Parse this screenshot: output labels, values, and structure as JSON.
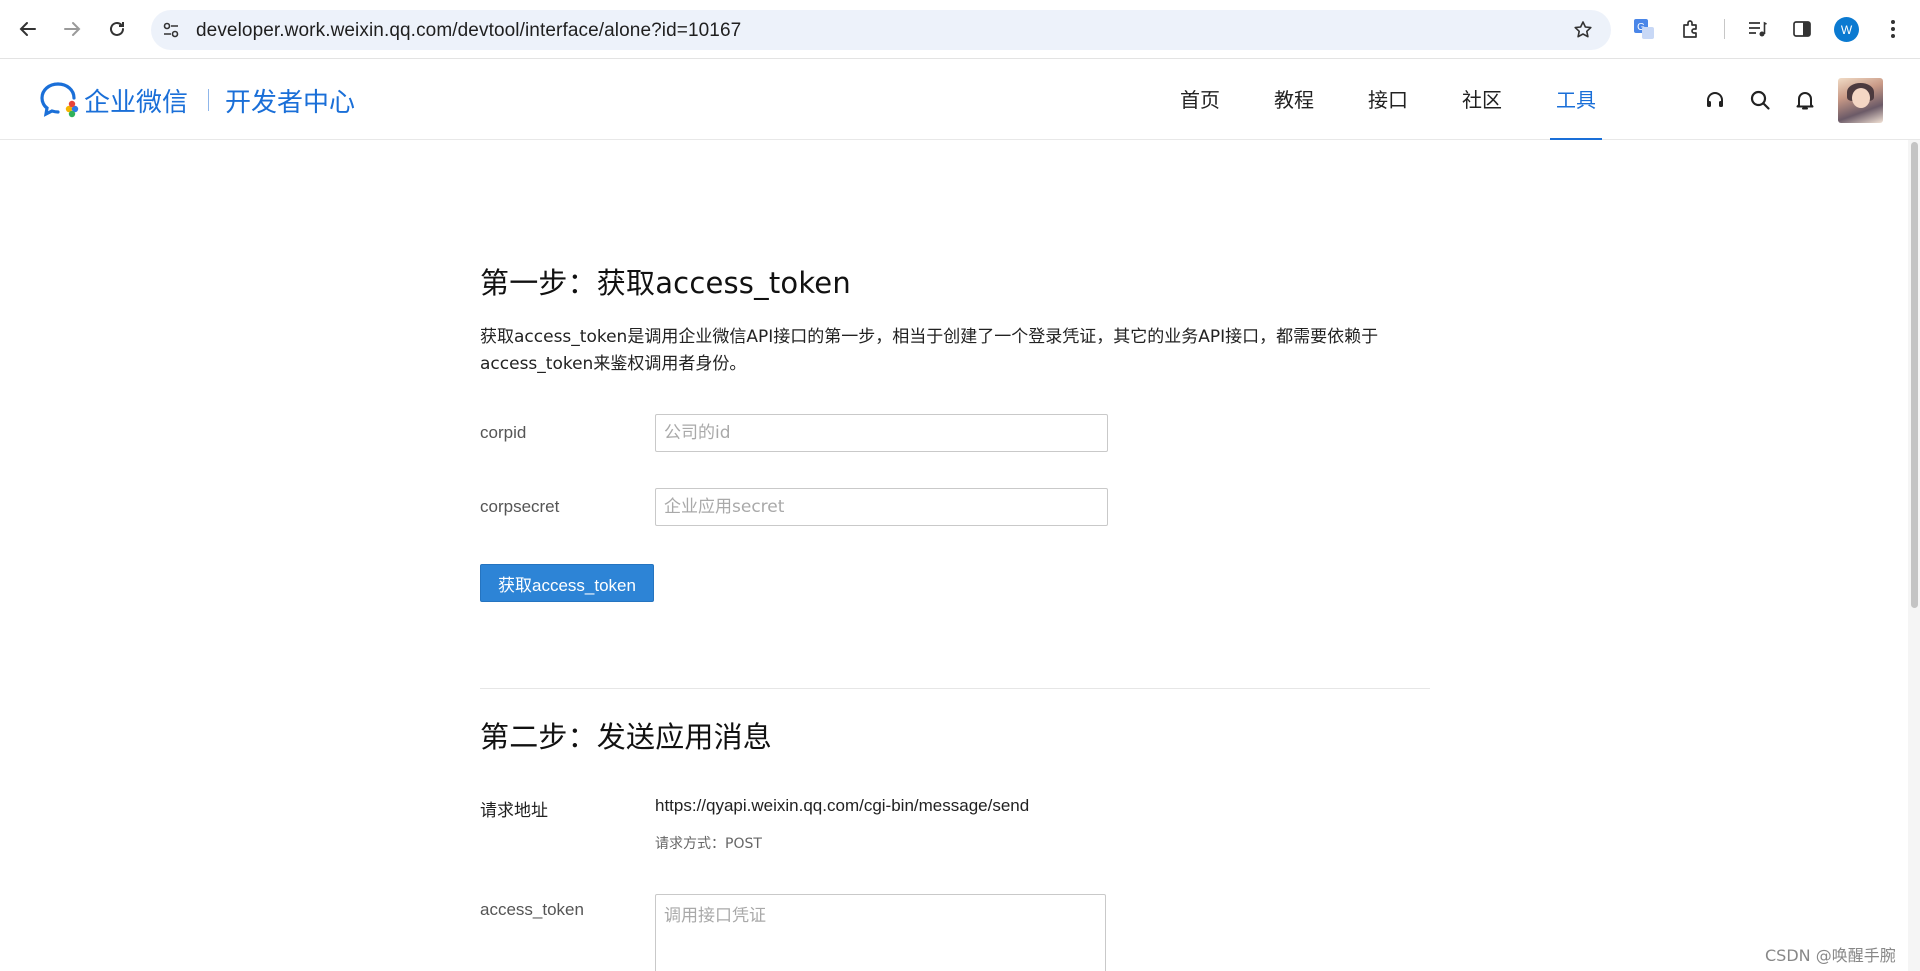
{
  "browser": {
    "url": "developer.work.weixin.qq.com/devtool/interface/alone?id=10167",
    "profile_initial": "W"
  },
  "site": {
    "brand": "企业微信",
    "sub_brand": "开发者中心",
    "nav": [
      "首页",
      "教程",
      "接口",
      "社区",
      "工具"
    ],
    "active_nav": "工具",
    "accent_color": "#1a6fd8"
  },
  "step1": {
    "title": "第一步：获取access_token",
    "description": "获取access_token是调用企业微信API接口的第一步，相当于创建了一个登录凭证，其它的业务API接口，都需要依赖于access_token来鉴权调用者身份。",
    "fields": [
      {
        "label": "corpid",
        "placeholder": "公司的id"
      },
      {
        "label": "corpsecret",
        "placeholder": "企业应用secret"
      }
    ],
    "button_label": "获取access_token"
  },
  "step2": {
    "title": "第二步：发送应用消息",
    "request_url_label": "请求地址",
    "request_url": "https://qyapi.weixin.qq.com/cgi-bin/message/send",
    "request_method": "请求方式：POST",
    "token_label": "access_token",
    "token_placeholder": "调用接口凭证"
  },
  "watermark": "CSDN @唤醒手腕"
}
